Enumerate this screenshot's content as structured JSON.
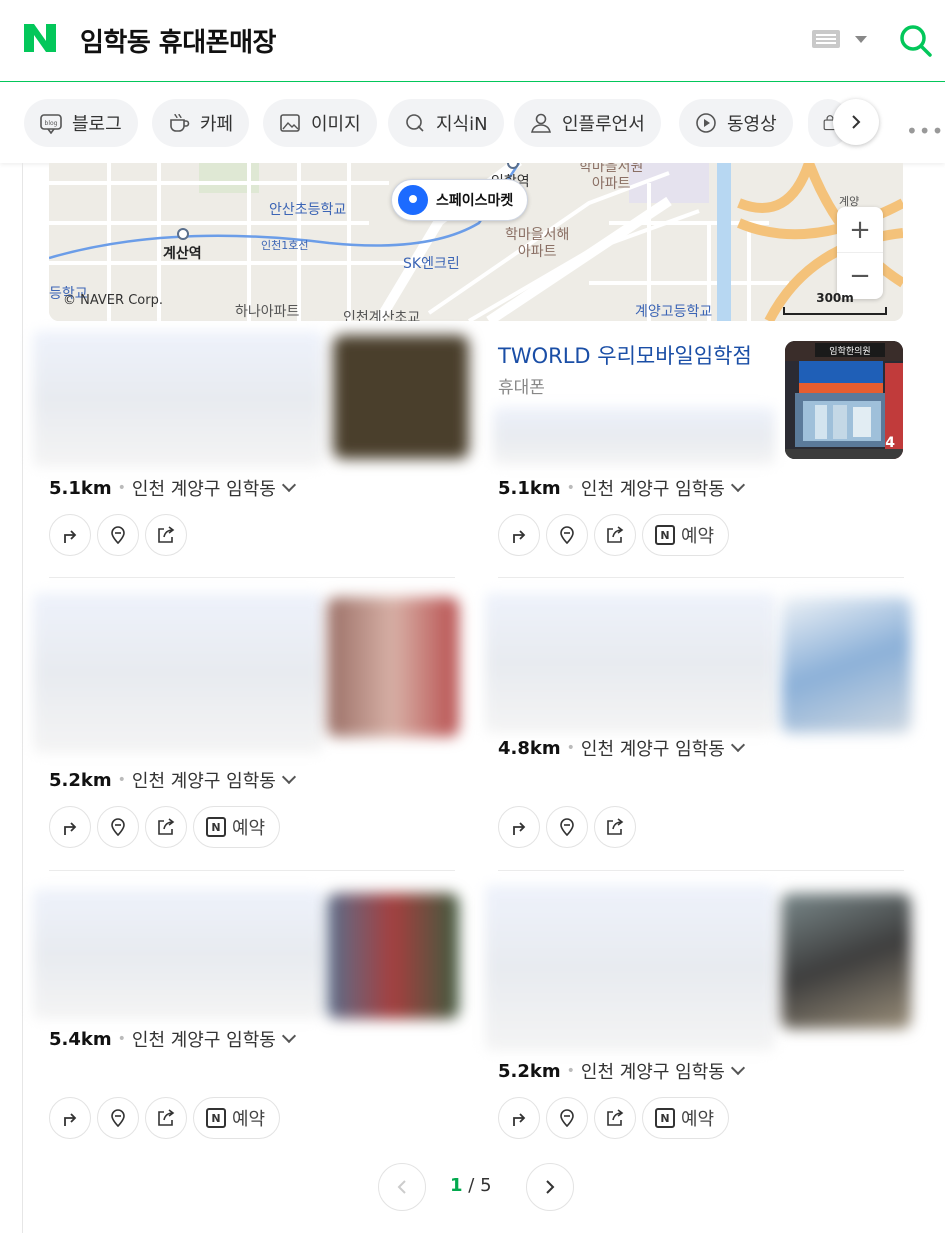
{
  "header": {
    "query": "임학동 휴대폰매장"
  },
  "tabs": [
    {
      "label": "블로그",
      "icon": "blog-icon"
    },
    {
      "label": "카페",
      "icon": "cafe-cup-icon"
    },
    {
      "label": "이미지",
      "icon": "image-icon"
    },
    {
      "label": "지식iN",
      "icon": "knowledge-q-icon"
    },
    {
      "label": "인플루언서",
      "icon": "person-icon"
    },
    {
      "label": "동영상",
      "icon": "play-icon"
    }
  ],
  "map": {
    "pin_label": "스페이스마켓",
    "labels": [
      "인학역",
      "학마을서원\n아파트",
      "안산초등학교",
      "계산역",
      "인천1호선",
      "SK엔크린",
      "학마을서해\n아파트",
      "하나아파트",
      "인천계산초교",
      "계양고등학교",
      "등학교",
      "계양"
    ],
    "copyright": "© NAVER Corp.",
    "scale": "300m",
    "zoom_in": "+",
    "zoom_out": "−"
  },
  "cards": [
    {
      "distance": "5.1km",
      "address": "인천 계양구 임학동",
      "reserve": false
    },
    {
      "title": "TWORLD 우리모바일임학점",
      "category": "휴대폰",
      "photo_count": "4",
      "distance": "5.1km",
      "address": "인천 계양구 임학동",
      "reserve": true,
      "reserve_label": "예약",
      "n_badge": "N"
    },
    {
      "distance": "5.2km",
      "address": "인천 계양구 임학동",
      "reserve": true,
      "reserve_label": "예약",
      "n_badge": "N"
    },
    {
      "distance": "4.8km",
      "address": "인천 계양구 임학동",
      "reserve": false
    },
    {
      "distance": "5.4km",
      "address": "인천 계양구 임학동",
      "reserve": true,
      "reserve_label": "예약",
      "n_badge": "N"
    },
    {
      "distance": "5.2km",
      "address": "인천 계양구 임학동",
      "reserve": true,
      "reserve_label": "예약",
      "n_badge": "N"
    }
  ],
  "photo_sign": "임학한의원",
  "pagination": {
    "current": "1",
    "separator": "/",
    "total": "5"
  },
  "colors": {
    "brand": "#03c75a",
    "link": "#1a4ea6",
    "pin": "#1c6bff"
  }
}
